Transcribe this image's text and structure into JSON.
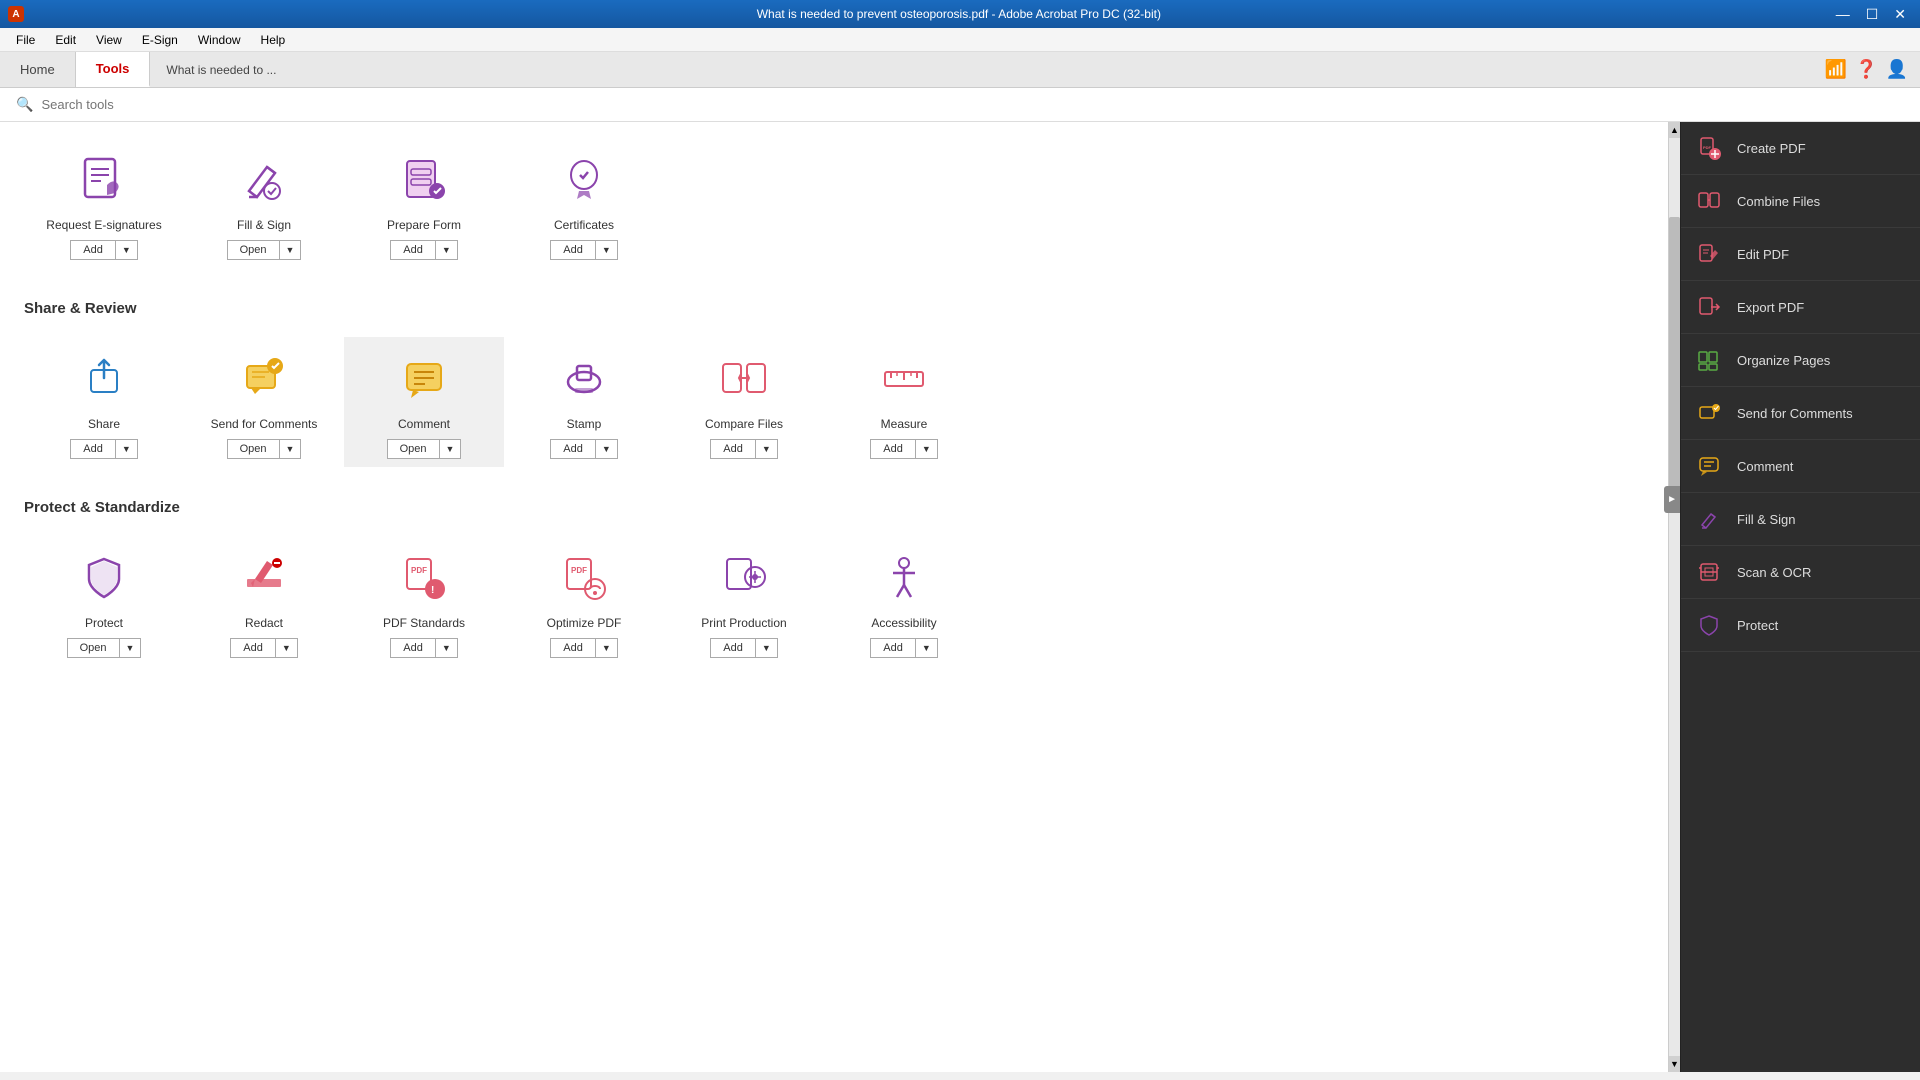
{
  "titleBar": {
    "title": "What is needed to prevent osteoporosis.pdf - Adobe Acrobat Pro DC (32-bit)",
    "controls": [
      "—",
      "□",
      "✕"
    ]
  },
  "menuBar": {
    "items": [
      "File",
      "Edit",
      "View",
      "E-Sign",
      "Window",
      "Help"
    ]
  },
  "tabs": {
    "home": "Home",
    "tools": "Tools",
    "docTab": "What is needed to ..."
  },
  "search": {
    "placeholder": "Search tools"
  },
  "sections": [
    {
      "id": "sign-forms",
      "title": null,
      "tools": [
        {
          "name": "Request E-signatures",
          "btnLabel": "Add",
          "hasDropdown": true,
          "color": "#8b44ac",
          "iconType": "request-esign"
        },
        {
          "name": "Fill & Sign",
          "btnLabel": "Open",
          "hasDropdown": true,
          "color": "#8b44ac",
          "iconType": "fill-sign"
        },
        {
          "name": "Prepare Form",
          "btnLabel": "Add",
          "hasDropdown": true,
          "color": "#8b44ac",
          "iconType": "prepare-form"
        },
        {
          "name": "Certificates",
          "btnLabel": "Add",
          "hasDropdown": true,
          "color": "#8b44ac",
          "iconType": "certificates"
        }
      ]
    },
    {
      "id": "share-review",
      "title": "Share & Review",
      "tools": [
        {
          "name": "Share",
          "btnLabel": "Add",
          "hasDropdown": true,
          "color": "#2a7fc4",
          "iconType": "share"
        },
        {
          "name": "Send for Comments",
          "btnLabel": "Open",
          "hasDropdown": true,
          "color": "#e6a817",
          "iconType": "send-comments"
        },
        {
          "name": "Comment",
          "btnLabel": "Open",
          "hasDropdown": true,
          "color": "#e6a817",
          "iconType": "comment"
        },
        {
          "name": "Stamp",
          "btnLabel": "Add",
          "hasDropdown": true,
          "color": "#8b44ac",
          "iconType": "stamp"
        },
        {
          "name": "Compare Files",
          "btnLabel": "Add",
          "hasDropdown": true,
          "color": "#e05a6f",
          "iconType": "compare-files"
        },
        {
          "name": "Measure",
          "btnLabel": "Add",
          "hasDropdown": true,
          "color": "#e05a6f",
          "iconType": "measure"
        }
      ]
    },
    {
      "id": "protect-standardize",
      "title": "Protect & Standardize",
      "tools": [
        {
          "name": "Protect",
          "btnLabel": "Open",
          "hasDropdown": true,
          "color": "#8b44ac",
          "iconType": "protect"
        },
        {
          "name": "Redact",
          "btnLabel": "Add",
          "hasDropdown": true,
          "color": "#e05a6f",
          "iconType": "redact"
        },
        {
          "name": "PDF Standards",
          "btnLabel": "Add",
          "hasDropdown": true,
          "color": "#e05a6f",
          "iconType": "pdf-standards"
        },
        {
          "name": "Optimize PDF",
          "btnLabel": "Add",
          "hasDropdown": true,
          "color": "#e05a6f",
          "iconType": "optimize-pdf"
        },
        {
          "name": "Print Production",
          "btnLabel": "Add",
          "hasDropdown": true,
          "color": "#8b44ac",
          "iconType": "print-production"
        },
        {
          "name": "Accessibility",
          "btnLabel": "Add",
          "hasDropdown": true,
          "color": "#8b44ac",
          "iconType": "accessibility"
        }
      ]
    }
  ],
  "rightPanel": {
    "items": [
      {
        "label": "Create PDF",
        "iconType": "create-pdf",
        "color": "#e05a6f"
      },
      {
        "label": "Combine Files",
        "iconType": "combine-files",
        "color": "#e05a6f"
      },
      {
        "label": "Edit PDF",
        "iconType": "edit-pdf",
        "color": "#e05a6f"
      },
      {
        "label": "Export PDF",
        "iconType": "export-pdf",
        "color": "#e05a6f"
      },
      {
        "label": "Organize Pages",
        "iconType": "organize-pages",
        "color": "#5aac44"
      },
      {
        "label": "Send for Comments",
        "iconType": "send-comments-right",
        "color": "#e6a817"
      },
      {
        "label": "Comment",
        "iconType": "comment-right",
        "color": "#e6a817"
      },
      {
        "label": "Fill & Sign",
        "iconType": "fill-sign-right",
        "color": "#8b44ac"
      },
      {
        "label": "Scan & OCR",
        "iconType": "scan-ocr",
        "color": "#e05a6f"
      },
      {
        "label": "Protect",
        "iconType": "protect-right",
        "color": "#8b44ac"
      }
    ]
  }
}
